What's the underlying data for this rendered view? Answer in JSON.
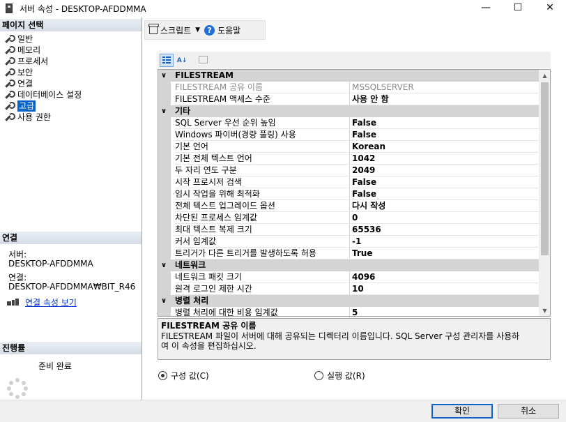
{
  "window": {
    "title": "서버 속성 - DESKTOP-AFDDMMA",
    "minimize": "—",
    "maximize": "☐",
    "close": "✕"
  },
  "left": {
    "page_select_header": "페이지 선택",
    "nav_items": [
      "일반",
      "메모리",
      "프로세서",
      "보안",
      "연결",
      "데이터베이스 설정",
      "고급",
      "사용 권한"
    ],
    "selected_index": 6,
    "connection_header": "연결",
    "server_label": "서버:",
    "server_value": "DESKTOP-AFDDMMA",
    "connection_label": "연결:",
    "connection_value": "DESKTOP-AFDDMMA₩BIT_R46",
    "view_conn_props": "연결 속성 보기",
    "progress_header": "진행률",
    "progress_status": "준비 완료"
  },
  "toolbar": {
    "script_label": "스크립트",
    "help_label": "도움말"
  },
  "grid": {
    "categories": [
      {
        "name": "FILESTREAM",
        "props": [
          {
            "name": "FILESTREAM 공유 이름",
            "value": "MSSQLSERVER",
            "state": "disabled"
          },
          {
            "name": "FILESTREAM 액세스 수준",
            "value": "사용 안 함",
            "state": "bold"
          }
        ]
      },
      {
        "name": "기타",
        "props": [
          {
            "name": "SQL Server 우선 순위 높임",
            "value": "False",
            "state": "bold"
          },
          {
            "name": "Windows 파이버(경량 풀링) 사용",
            "value": "False",
            "state": "bold"
          },
          {
            "name": "기본 언어",
            "value": "Korean",
            "state": "bold"
          },
          {
            "name": "기본 전체 텍스트 언어",
            "value": "1042",
            "state": "bold"
          },
          {
            "name": "두 자리 연도 구분",
            "value": "2049",
            "state": "bold"
          },
          {
            "name": "시작 프로시저 검색",
            "value": "False",
            "state": "bold"
          },
          {
            "name": "임시 작업을 위해 최적화",
            "value": "False",
            "state": "bold"
          },
          {
            "name": "전체 텍스트 업그레이드 옵션",
            "value": "다시 작성",
            "state": "bold"
          },
          {
            "name": "차단된 프로세스 임계값",
            "value": "0",
            "state": "bold"
          },
          {
            "name": "최대 텍스트 복제 크기",
            "value": "65536",
            "state": "bold"
          },
          {
            "name": "커서 임계값",
            "value": "-1",
            "state": "bold"
          },
          {
            "name": "트리거가 다른 트리거를 발생하도록 허용",
            "value": "True",
            "state": "bold"
          }
        ]
      },
      {
        "name": "네트워크",
        "props": [
          {
            "name": "네트워크 패킷 크기",
            "value": "4096",
            "state": "bold"
          },
          {
            "name": "원격 로그인 제한 시간",
            "value": "10",
            "state": "bold"
          }
        ]
      },
      {
        "name": "병렬 처리",
        "props": [
          {
            "name": "병렬 처리에 대한 비용 임계값",
            "value": "5",
            "state": "bold"
          }
        ]
      }
    ]
  },
  "description": {
    "title": "FILESTREAM 공유 이름",
    "line1": "FILESTREAM 파일이 서버에 대해 공유되는 디렉터리 이름입니다. SQL Server 구성 관리자를 사용하",
    "line2": "여 이 속성을 편집하십시오."
  },
  "radios": {
    "configured_label": "구성 값(C)",
    "running_label": "실행 값(R)",
    "selected": "configured"
  },
  "buttons": {
    "ok": "확인",
    "cancel": "취소"
  }
}
